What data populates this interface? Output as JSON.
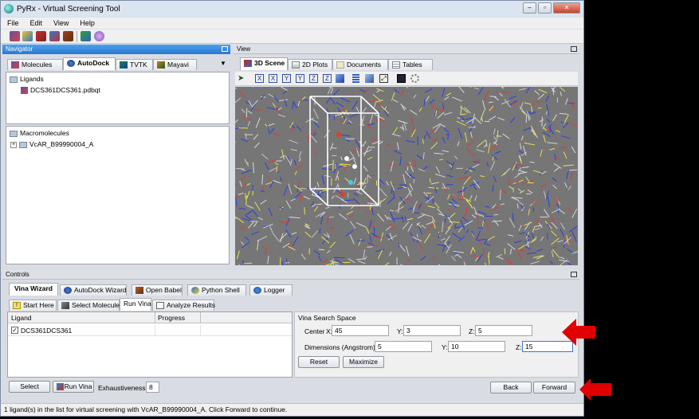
{
  "window": {
    "title": "PyRx - Virtual Screening Tool"
  },
  "menu": [
    "File",
    "Edit",
    "View",
    "Help"
  ],
  "navigator": {
    "title": "Navigator",
    "tabs": [
      "Molecules",
      "AutoDock",
      "TVTK",
      "Mayavi"
    ],
    "selected_tab": "AutoDock",
    "ligands_label": "Ligands",
    "ligand_item": "DCS361DCS361.pdbqt",
    "macromolecules_label": "Macromolecules",
    "macromolecule_item": "VcAR_B99990004_A"
  },
  "view": {
    "title": "View",
    "tabs": [
      "3D Scene",
      "2D Plots",
      "Documents",
      "Tables"
    ],
    "selected_tab": "3D Scene"
  },
  "controls": {
    "title": "Controls",
    "tabs": [
      "Vina Wizard",
      "AutoDock Wizard",
      "Open Babel",
      "Python Shell",
      "Logger"
    ],
    "selected_tab": "Vina Wizard",
    "subtabs": [
      "Start Here",
      "Select Molecules",
      "Run Vina",
      "Analyze Results"
    ],
    "selected_subtab": "Run Vina",
    "table_headers": [
      "Ligand",
      "Progress"
    ],
    "table_rows": [
      {
        "ligand": "DCS361DCS361",
        "progress": ""
      }
    ],
    "search_space": {
      "title": "Vina Search Space",
      "center_label": "Center",
      "center_x_label": "X:",
      "center_x": "45",
      "center_y_label": "Y:",
      "center_y": "3",
      "center_z_label": "Z:",
      "center_z": "5",
      "dims_label": "Dimensions (Angstrom) X:",
      "dims_x": "5",
      "dims_y_label": "Y:",
      "dims_y": "10",
      "dims_z_label": "Z:",
      "dims_z": "15",
      "reset_label": "Reset",
      "maximize_label": "Maximize"
    },
    "select_label": "Select",
    "run_vina_label": "Run Vina",
    "exhaustiveness_label": "Exhaustiveness:",
    "exhaustiveness": "8",
    "back_label": "Back",
    "forward_label": "Forward"
  },
  "status": "1 ligand(s) in the list for virtual screening with VcAR_B99990004_A. Click Forward to continue.",
  "colors": {
    "annotation_arrow": "#e00000",
    "navigator_header": "#2a78d0",
    "scene_bg": "#767676"
  }
}
